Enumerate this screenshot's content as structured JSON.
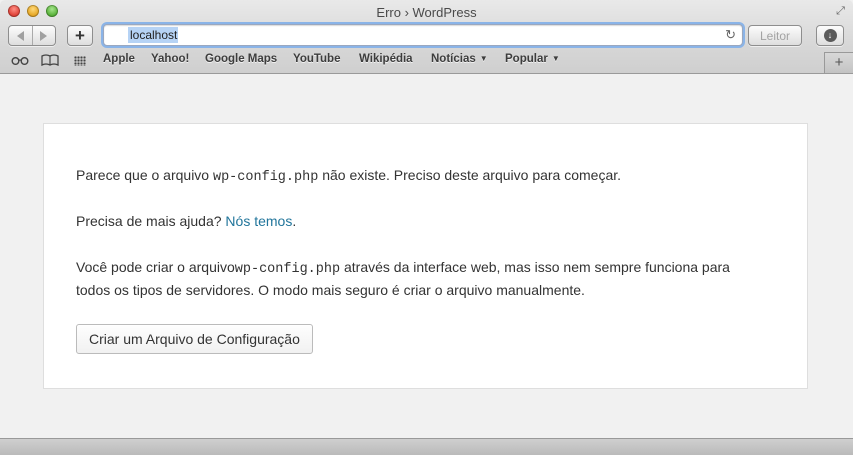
{
  "window": {
    "title": "Erro › WordPress"
  },
  "toolbar": {
    "add_label": "+",
    "url": "localhost",
    "reader_label": "Leitor"
  },
  "bookmarks": {
    "items": [
      {
        "label": "Apple"
      },
      {
        "label": "Yahoo!"
      },
      {
        "label": "Google Maps"
      },
      {
        "label": "YouTube"
      },
      {
        "label": "Wikipédia"
      },
      {
        "label": "Notícias"
      },
      {
        "label": "Popular"
      }
    ],
    "newtab_label": "+"
  },
  "page": {
    "p1_before": "Parece que o arquivo ",
    "p1_code": "wp-config.php",
    "p1_after": " não existe. Preciso deste arquivo para começar.",
    "p2_before": "Precisa de mais ajuda? ",
    "p2_link": "Nós temos",
    "p2_after": ".",
    "p3_line1_before": "Você pode criar o arquivo",
    "p3_code": "wp-config.php",
    "p3_line1_after": " através da interface web, mas isso nem sempre funciona para",
    "p3_line2": "todos os tipos de servidores. O modo mais seguro é criar o arquivo manualmente.",
    "button_label": "Criar um Arquivo de Configuração"
  },
  "colors": {
    "link": "#21759b",
    "url_selection": "#b6d3f5",
    "focus_ring": "#8ab4e8"
  }
}
